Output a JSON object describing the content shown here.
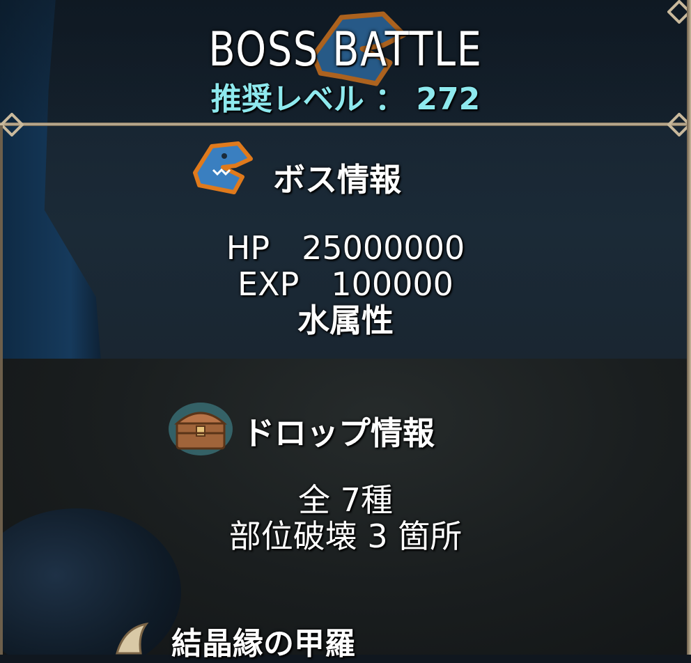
{
  "header": {
    "title": "BOSS  BATTLE",
    "recommended_level": "推奨レベル ： 272"
  },
  "boss_info": {
    "heading": "ボス情報",
    "icon": "shark-head-icon",
    "hp": "HP　25000000",
    "exp": "EXP　100000",
    "element": "水属性"
  },
  "drop_info": {
    "heading": "ドロップ情報",
    "icon": "treasure-chest-icon",
    "total": "全 7種",
    "breakable_parts": "部位破壊 3 箇所",
    "first_item": "結晶縁の甲羅",
    "first_item_icon": "claw-icon"
  },
  "colors": {
    "accent_cyan": "#8ee9ee",
    "frame_gold": "#c9b99c",
    "text": "#ffffff"
  }
}
